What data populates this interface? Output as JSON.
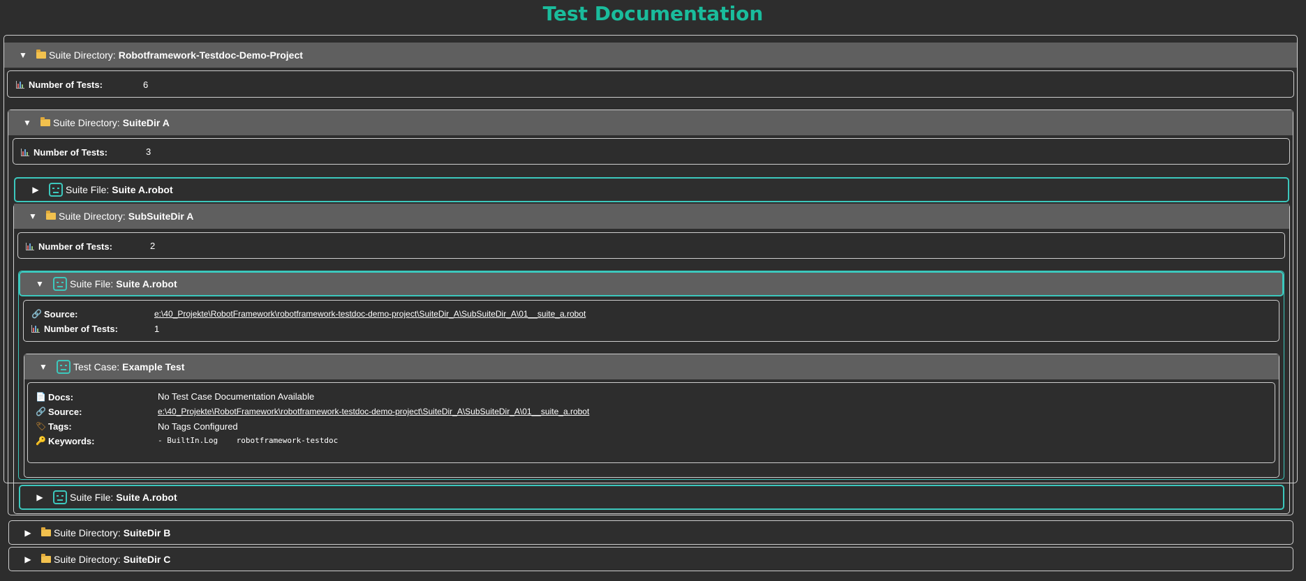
{
  "page": {
    "title": "Test Documentation"
  },
  "labels": {
    "suite_directory": "Suite Directory:",
    "suite_file": "Suite File:",
    "test_case": "Test Case:",
    "number_of_tests": "Number of Tests:",
    "source": "Source:",
    "docs": "Docs:",
    "tags": "Tags:",
    "keywords": "Keywords:"
  },
  "root": {
    "name": "Robotframework-Testdoc-Demo-Project",
    "number_of_tests": "6"
  },
  "suite_dir_a": {
    "name": "SuiteDir A",
    "number_of_tests": "3",
    "file_1": {
      "name": "Suite A.robot"
    },
    "sub_dir": {
      "name": "SubSuiteDir A",
      "number_of_tests": "2",
      "file_open": {
        "name": "Suite A.robot",
        "source": "e:\\40_Projekte\\RobotFramework\\robotframework-testdoc-demo-project\\SuiteDir_A\\SubSuiteDir_A\\01__suite_a.robot",
        "number_of_tests": "1",
        "test_case": {
          "name": "Example Test",
          "docs": "No Test Case Documentation Available",
          "source": "e:\\40_Projekte\\RobotFramework\\robotframework-testdoc-demo-project\\SuiteDir_A\\SubSuiteDir_A\\01__suite_a.robot",
          "tags": "No Tags Configured",
          "keywords": "- BuiltIn.Log    robotframework-testdoc"
        }
      },
      "file_2": {
        "name": "Suite A.robot"
      }
    }
  },
  "suite_dir_b": {
    "name": "SuiteDir B"
  },
  "suite_dir_c": {
    "name": "SuiteDir C"
  },
  "icons": {
    "expanded": "expanded-triangle-icon",
    "collapsed": "collapsed-triangle-icon",
    "folder": "folder-icon",
    "robot": "robot-icon",
    "chart": "bar-chart-icon",
    "link": "link-icon",
    "doc": "document-icon",
    "tag": "tag-icon",
    "key": "key-icon"
  },
  "colors": {
    "background": "#2d2d2d",
    "header": "#5f5f5f",
    "accent": "#1abc9c",
    "file_border": "#3cc8bd"
  }
}
